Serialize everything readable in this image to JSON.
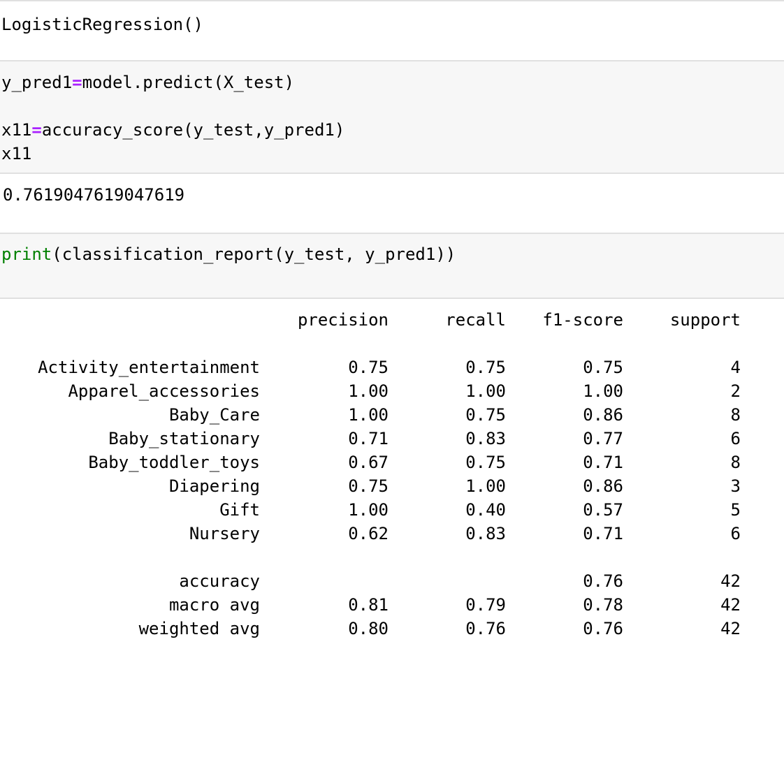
{
  "cells": {
    "out1": {
      "text": "LogisticRegression()"
    },
    "in2": {
      "line1_a": "y_pred1",
      "line1_op": "=",
      "line1_b": "model.predict(X_test)",
      "line2_a": "x11",
      "line2_op": "=",
      "line2_b": "accuracy_score(y_test,y_pred1)",
      "line3": "x11"
    },
    "out2": {
      "text": "0.7619047619047619"
    },
    "in3": {
      "fn": "print",
      "rest": "(classification_report(y_test, y_pred1))"
    }
  },
  "report": {
    "headers": {
      "precision": "precision",
      "recall": "recall",
      "f1": "f1-score",
      "support": "support"
    },
    "rows": [
      {
        "label": "Activity_entertainment",
        "precision": "0.75",
        "recall": "0.75",
        "f1": "0.75",
        "support": "4"
      },
      {
        "label": "Apparel_accessories",
        "precision": "1.00",
        "recall": "1.00",
        "f1": "1.00",
        "support": "2"
      },
      {
        "label": "Baby_Care",
        "precision": "1.00",
        "recall": "0.75",
        "f1": "0.86",
        "support": "8"
      },
      {
        "label": "Baby_stationary",
        "precision": "0.71",
        "recall": "0.83",
        "f1": "0.77",
        "support": "6"
      },
      {
        "label": "Baby_toddler_toys",
        "precision": "0.67",
        "recall": "0.75",
        "f1": "0.71",
        "support": "8"
      },
      {
        "label": "Diapering",
        "precision": "0.75",
        "recall": "1.00",
        "f1": "0.86",
        "support": "3"
      },
      {
        "label": "Gift",
        "precision": "1.00",
        "recall": "0.40",
        "f1": "0.57",
        "support": "5"
      },
      {
        "label": "Nursery",
        "precision": "0.62",
        "recall": "0.83",
        "f1": "0.71",
        "support": "6"
      }
    ],
    "summary": [
      {
        "label": "accuracy",
        "precision": "",
        "recall": "",
        "f1": "0.76",
        "support": "42"
      },
      {
        "label": "macro avg",
        "precision": "0.81",
        "recall": "0.79",
        "f1": "0.78",
        "support": "42"
      },
      {
        "label": "weighted avg",
        "precision": "0.80",
        "recall": "0.76",
        "f1": "0.76",
        "support": "42"
      }
    ]
  }
}
